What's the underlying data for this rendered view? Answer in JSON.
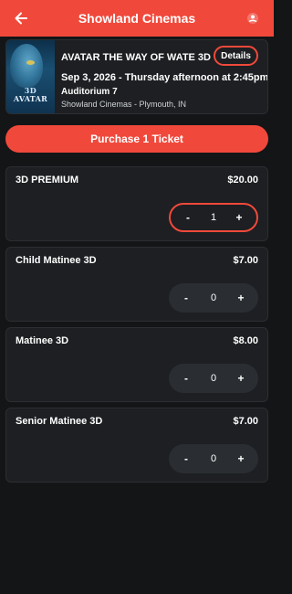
{
  "header": {
    "title": "Showland Cinemas",
    "back_icon": "arrow-left-icon",
    "account_icon": "account-circle-icon",
    "color": "#f0493b"
  },
  "movie": {
    "title": "AVATAR THE WAY OF WATE 3D",
    "details_label": "Details",
    "showtime": "Sep 3, 2026 - Thursday afternoon at 2:45pm",
    "auditorium": "Auditorium 7",
    "venue": "Showland Cinemas - Plymouth, IN",
    "poster": {
      "badge": "3D",
      "title": "AVATAR"
    }
  },
  "purchase": {
    "label": "Purchase 1 Ticket"
  },
  "tickets": [
    {
      "name": "3D PREMIUM",
      "price": "$20.00",
      "quantity": "1",
      "minus": "-",
      "plus": "+"
    },
    {
      "name": "Child Matinee 3D",
      "price": "$7.00",
      "quantity": "0",
      "minus": "-",
      "plus": "+"
    },
    {
      "name": "Matinee 3D",
      "price": "$8.00",
      "quantity": "0",
      "minus": "-",
      "plus": "+"
    },
    {
      "name": "Senior Matinee 3D",
      "price": "$7.00",
      "quantity": "0",
      "minus": "-",
      "plus": "+"
    }
  ],
  "colors": {
    "accent": "#f0493b",
    "background": "#141517",
    "card": "#1d1f22"
  }
}
